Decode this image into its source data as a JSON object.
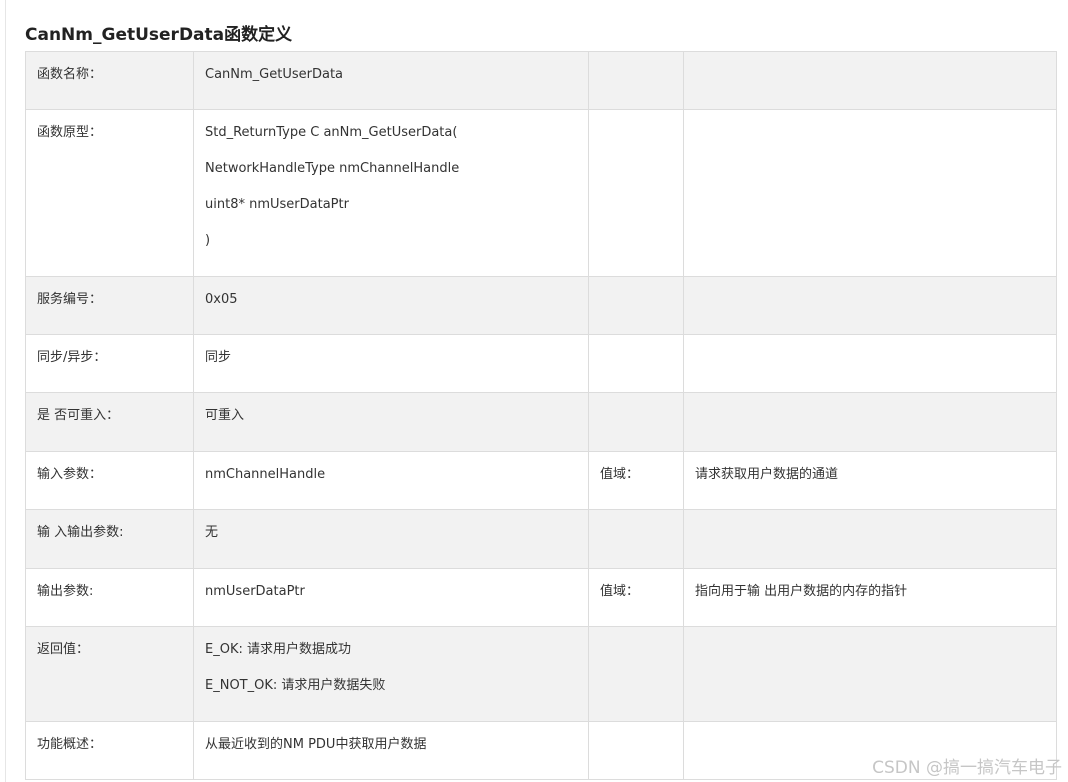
{
  "title": "CanNm_GetUserData函数定义",
  "rows": [
    {
      "label": "函数名称：",
      "value_lines": [
        "CanNm_GetUserData"
      ],
      "extra_label": "",
      "extra_value": ""
    },
    {
      "label": "函数原型：",
      "value_lines": [
        "Std_ReturnType C anNm_GetUserData(",
        "NetworkHandleType nmChannelHandle",
        "uint8* nmUserDataPtr",
        ")"
      ],
      "extra_label": "",
      "extra_value": ""
    },
    {
      "label": "服务编号：",
      "value_lines": [
        "0x05"
      ],
      "extra_label": "",
      "extra_value": ""
    },
    {
      "label": "同步/异步：",
      "value_lines": [
        "同步"
      ],
      "extra_label": "",
      "extra_value": ""
    },
    {
      "label": "是 否可重入：",
      "value_lines": [
        "可重入"
      ],
      "extra_label": "",
      "extra_value": ""
    },
    {
      "label": "输入参数：",
      "value_lines": [
        "nmChannelHandle"
      ],
      "extra_label": "值域：",
      "extra_value": "请求获取用户数据的通道"
    },
    {
      "label": "输 入输出参数:",
      "value_lines": [
        "无"
      ],
      "extra_label": "",
      "extra_value": ""
    },
    {
      "label": "输出参数:",
      "value_lines": [
        "nmUserDataPtr"
      ],
      "extra_label": "值域：",
      "extra_value": "指向用于输 出用户数据的内存的指针"
    },
    {
      "label": "返回值：",
      "value_lines": [
        "E_OK: 请求用户数据成功",
        "E_NOT_OK: 请求用户数据失败"
      ],
      "extra_label": "",
      "extra_value": ""
    },
    {
      "label": "功能概述：",
      "value_lines": [
        "从最近收到的NM PDU中获取用户数据"
      ],
      "extra_label": "",
      "extra_value": ""
    }
  ],
  "watermark": "CSDN @搞一搞汽车电子"
}
